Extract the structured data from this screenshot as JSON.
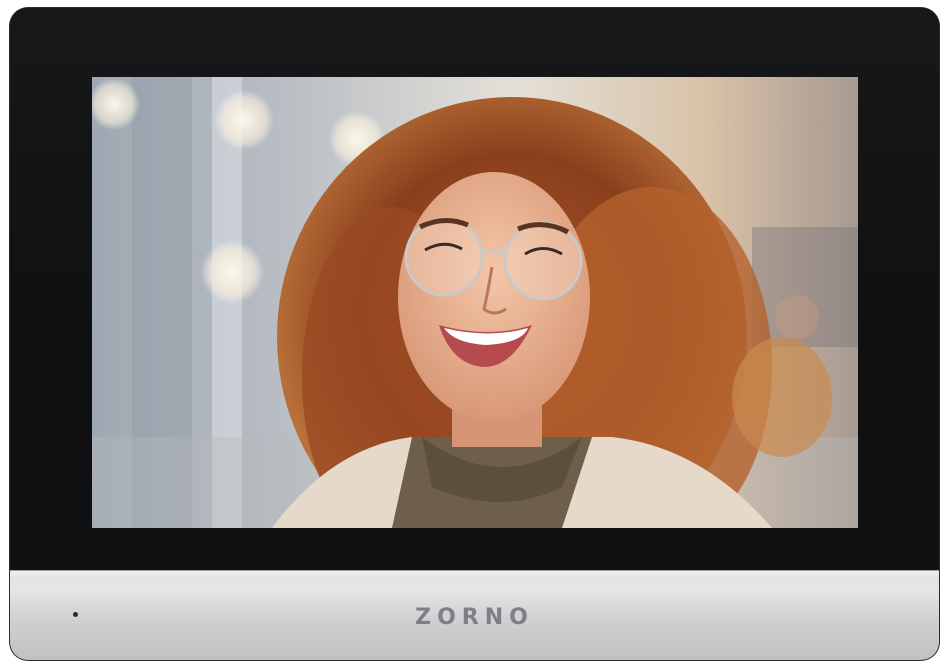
{
  "device": {
    "brand_text": "ZORNO",
    "colors": {
      "bezel": "#111213",
      "panel": "#d3d4d6",
      "brand": "#7e8083"
    }
  },
  "screen": {
    "content": "video-feed-photo"
  }
}
